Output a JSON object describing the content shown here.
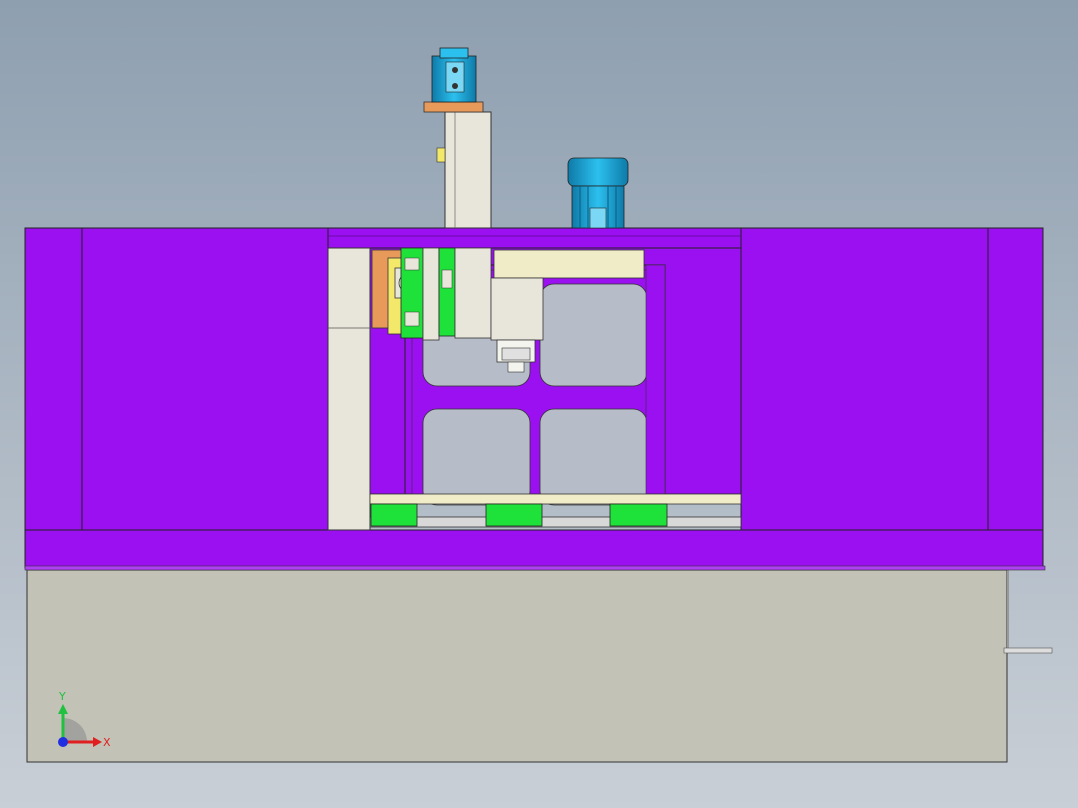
{
  "view": {
    "background_top": "#8e9fb0",
    "background_bottom": "#c9cfd6"
  },
  "colors": {
    "frame_purple": "#9b10f0",
    "panel_beige": "#e8e6da",
    "rail_green": "#1ee23a",
    "motor_blue": "#18a8d8",
    "base_gray": "#c2c2b6",
    "bracket_orange": "#e89a5a",
    "yellow_block": "#f4e86a",
    "outline": "#222222"
  },
  "triad": {
    "x_label": "X",
    "y_label": "Y",
    "x_color": "#e02020",
    "y_color": "#20c040",
    "z_color": "#2030e0"
  }
}
